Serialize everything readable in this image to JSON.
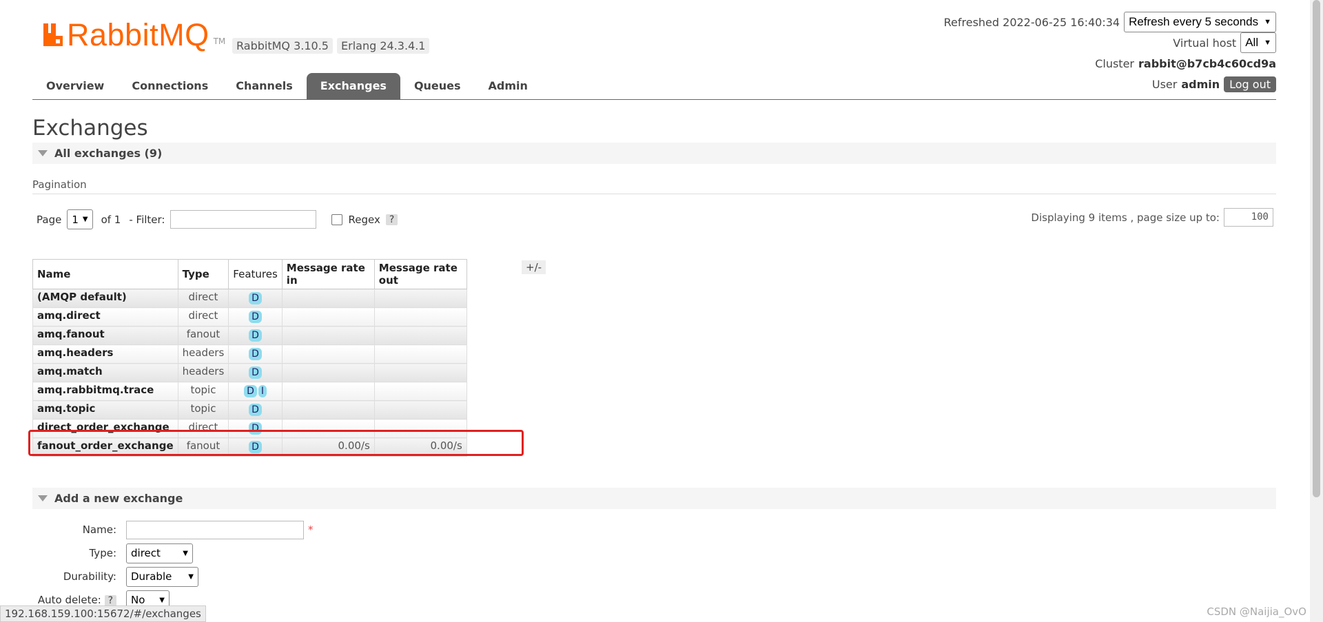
{
  "app": {
    "logo_text": "RabbitMQ",
    "logo_tm": "TM",
    "version_label": "RabbitMQ 3.10.5",
    "erlang_label": "Erlang 24.3.4.1"
  },
  "header": {
    "refreshed_text": "Refreshed 2022-06-25 16:40:34",
    "refresh_select": "Refresh every 5 seconds",
    "vhost_label": "Virtual host",
    "vhost_value": "All",
    "cluster_label": "Cluster",
    "cluster_value": "rabbit@b7cb4c60cd9a",
    "user_label": "User",
    "user_value": "admin",
    "logout_label": "Log out"
  },
  "nav": {
    "tabs": [
      {
        "label": "Overview"
      },
      {
        "label": "Connections"
      },
      {
        "label": "Channels"
      },
      {
        "label": "Exchanges"
      },
      {
        "label": "Queues"
      },
      {
        "label": "Admin"
      }
    ],
    "active": "Exchanges"
  },
  "page": {
    "title": "Exchanges",
    "section_title": "All exchanges (9)",
    "pagination_title": "Pagination"
  },
  "pagination": {
    "page_label": "Page",
    "page_value": "1",
    "of_label": "of 1",
    "filter_label": "- Filter:",
    "filter_value": "",
    "regex_label": "Regex",
    "help_label": "?",
    "display_text": "Displaying 9 items , page size up to:",
    "page_size": "100"
  },
  "table": {
    "headers": [
      "Name",
      "Type",
      "Features",
      "Message rate in",
      "Message rate out"
    ],
    "toggle_label": "+/-",
    "rows": [
      {
        "name": "(AMQP default)",
        "type": "direct",
        "features": [
          "D"
        ],
        "rate_in": "",
        "rate_out": ""
      },
      {
        "name": "amq.direct",
        "type": "direct",
        "features": [
          "D"
        ],
        "rate_in": "",
        "rate_out": ""
      },
      {
        "name": "amq.fanout",
        "type": "fanout",
        "features": [
          "D"
        ],
        "rate_in": "",
        "rate_out": ""
      },
      {
        "name": "amq.headers",
        "type": "headers",
        "features": [
          "D"
        ],
        "rate_in": "",
        "rate_out": ""
      },
      {
        "name": "amq.match",
        "type": "headers",
        "features": [
          "D"
        ],
        "rate_in": "",
        "rate_out": ""
      },
      {
        "name": "amq.rabbitmq.trace",
        "type": "topic",
        "features": [
          "D",
          "I"
        ],
        "rate_in": "",
        "rate_out": ""
      },
      {
        "name": "amq.topic",
        "type": "topic",
        "features": [
          "D"
        ],
        "rate_in": "",
        "rate_out": ""
      },
      {
        "name": "direct_order_exchange",
        "type": "direct",
        "features": [
          "D"
        ],
        "rate_in": "",
        "rate_out": ""
      },
      {
        "name": "fanout_order_exchange",
        "type": "fanout",
        "features": [
          "D"
        ],
        "rate_in": "0.00/s",
        "rate_out": "0.00/s"
      }
    ]
  },
  "add_form": {
    "section_title": "Add a new exchange",
    "name_label": "Name:",
    "name_value": "",
    "required_mark": "*",
    "type_label": "Type:",
    "type_value": "direct",
    "durability_label": "Durability:",
    "durability_value": "Durable",
    "autodelete_label": "Auto delete:",
    "autodelete_help": "?",
    "autodelete_value": "No"
  },
  "statusbar": {
    "url": "192.168.159.100:15672/#/exchanges"
  },
  "watermark": "CSDN @Naijia_OvO",
  "colors": {
    "brand": "#ff6600",
    "nav_active": "#666666",
    "feature_badge": "#8fdcee",
    "highlight": "#e02020"
  }
}
